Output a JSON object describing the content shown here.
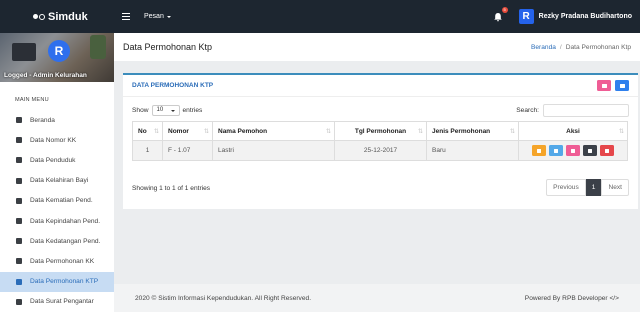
{
  "brand": {
    "name": "Simduk"
  },
  "topbar": {
    "menu_label": "Pesan",
    "notification_count": "5",
    "user_name": "Rezky Pradana Budihartono",
    "user_logo_letter": "R"
  },
  "sidebar": {
    "profile_label": "Logged - Admin Kelurahan",
    "avatar_letter": "R",
    "menu_title": "MAIN MENU",
    "items": [
      {
        "label": "Beranda",
        "icon": "dashboard-icon"
      },
      {
        "label": "Data Nomor KK",
        "icon": "id-card-icon"
      },
      {
        "label": "Data Penduduk",
        "icon": "person-icon"
      },
      {
        "label": "Data Kelahiran Bayi",
        "icon": "baby-icon"
      },
      {
        "label": "Data Kematian Pend.",
        "icon": "bed-icon"
      },
      {
        "label": "Data Kepindahan Pend.",
        "icon": "walking-icon"
      },
      {
        "label": "Data Kedatangan Pend.",
        "icon": "map-marker-icon"
      },
      {
        "label": "Data Permohonan KK",
        "icon": "user-icon"
      },
      {
        "label": "Data Permohonan KTP",
        "icon": "id-badge-icon",
        "active": true
      },
      {
        "label": "Data Surat Pengantar",
        "icon": "check-square-icon"
      }
    ]
  },
  "header": {
    "title": "Data Permohonan Ktp",
    "breadcrumb_home": "Beranda",
    "breadcrumb_current": "Data Permohonan Ktp"
  },
  "card": {
    "title": "DATA PERMOHONAN KTP",
    "show_label": "Show",
    "entries_value": "10",
    "entries_label": "entries",
    "search_label": "Search:",
    "search_value": "",
    "columns": [
      "No",
      "Nomor",
      "Nama Pemohon",
      "Tgl Permohonan",
      "Jenis Permohonan",
      "Aksi"
    ],
    "rows": [
      {
        "no": "1",
        "nomor": "F - 1.07",
        "nama": "Lastri",
        "tgl": "25-12-2017",
        "jenis": "Baru"
      }
    ],
    "info": "Showing 1 to 1 of 1 entries",
    "pagination": {
      "prev": "Previous",
      "current": "1",
      "next": "Next"
    }
  },
  "footer": {
    "left": "2020 © Sistim Informasi Kependudukan. All Right Reserved.",
    "right": "Powered By RPB Developer </>"
  },
  "colors": {
    "navbar": "#1d2630",
    "accent": "#2a6cb8",
    "active_menu_bg": "#c7dcf3"
  }
}
